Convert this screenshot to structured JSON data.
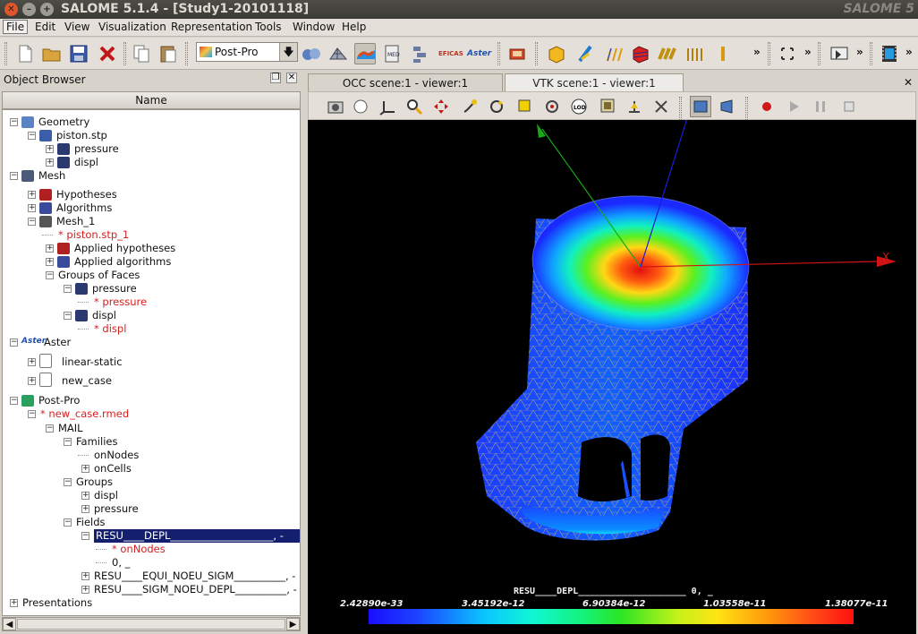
{
  "window": {
    "title": "SALOME 5.1.4 - [Study1-20101118]",
    "logo": "SALOME 5"
  },
  "menu": [
    "File",
    "Edit",
    "View",
    "Visualization",
    "Representation",
    "Tools",
    "Window",
    "Help"
  ],
  "toolbar": {
    "module_combo": "Post-Pro",
    "more": "»",
    "icons": [
      "new-document-icon",
      "open-folder-icon",
      "save-icon",
      "close-study-icon",
      "copy-icon",
      "paste-icon",
      "geometry-module-icon",
      "mesh-module-icon",
      "postpro-module-icon",
      "med-module-icon",
      "yacs-module-icon",
      "eficas-module-icon",
      "aster-module-icon",
      "import-med-icon",
      "create-scalar-map-icon",
      "create-deformed-shape-icon",
      "create-vectors-icon",
      "create-iso-surfaces-icon",
      "create-cut-planes-icon",
      "create-cut-lines-icon",
      "create-plot3d-icon",
      "select-icon",
      "dump-view-icon",
      "animation-icon"
    ],
    "eficas_label": "EFICAS",
    "aster_label": "Aster"
  },
  "object_browser": {
    "title": "Object Browser",
    "column_header": "Name",
    "tree": [
      {
        "label": "Geometry",
        "level": 0,
        "expander": "−",
        "red": false,
        "icon": "geometry-icon"
      },
      {
        "label": "piston.stp",
        "level": 1,
        "expander": "−",
        "red": false,
        "icon": "solid-icon"
      },
      {
        "label": "pressure",
        "level": 2,
        "expander": "+",
        "red": false,
        "icon": "face-group-icon"
      },
      {
        "label": "displ",
        "level": 2,
        "expander": "+",
        "red": false,
        "icon": "face-group-icon"
      },
      {
        "label": "Mesh",
        "level": 0,
        "expander": "−",
        "red": false,
        "icon": "mesh-icon"
      },
      {
        "label": "Hypotheses",
        "level": 1,
        "expander": "+",
        "red": false,
        "icon": "hypothesis-icon"
      },
      {
        "label": "Algorithms",
        "level": 1,
        "expander": "+",
        "red": false,
        "icon": "algorithm-icon"
      },
      {
        "label": "Mesh_1",
        "level": 1,
        "expander": "−",
        "red": false,
        "icon": "mesh-object-icon"
      },
      {
        "label": "* piston.stp_1",
        "level": 2,
        "expander": "",
        "red": true,
        "icon": ""
      },
      {
        "label": "Applied hypotheses",
        "level": 2,
        "expander": "+",
        "red": false,
        "icon": "hypothesis-icon"
      },
      {
        "label": "Applied algorithms",
        "level": 2,
        "expander": "+",
        "red": false,
        "icon": "algorithm-icon"
      },
      {
        "label": "Groups of Faces",
        "level": 2,
        "expander": "−",
        "red": false,
        "icon": ""
      },
      {
        "label": "pressure",
        "level": 3,
        "expander": "−",
        "red": false,
        "icon": "group-icon"
      },
      {
        "label": "* pressure",
        "level": 4,
        "expander": "",
        "red": true,
        "icon": ""
      },
      {
        "label": "displ",
        "level": 3,
        "expander": "−",
        "red": false,
        "icon": "group-icon"
      },
      {
        "label": "* displ",
        "level": 4,
        "expander": "",
        "red": true,
        "icon": ""
      },
      {
        "label": "Aster",
        "level": 0,
        "expander": "−",
        "red": false,
        "icon": "aster-icon"
      },
      {
        "label": "linear-static",
        "level": 1,
        "expander": "+",
        "red": false,
        "icon": "study-case-icon"
      },
      {
        "label": "new_case",
        "level": 1,
        "expander": "+",
        "red": false,
        "icon": "study-case-ok-icon"
      },
      {
        "label": "Post-Pro",
        "level": 0,
        "expander": "−",
        "red": false,
        "icon": "postpro-icon"
      },
      {
        "label": "* new_case.rmed",
        "level": 1,
        "expander": "−",
        "red": true,
        "icon": ""
      },
      {
        "label": "MAIL",
        "level": 2,
        "expander": "−",
        "red": false,
        "icon": ""
      },
      {
        "label": "Families",
        "level": 3,
        "expander": "−",
        "red": false,
        "icon": ""
      },
      {
        "label": "onNodes",
        "level": 4,
        "expander": "",
        "red": false,
        "icon": ""
      },
      {
        "label": "onCells",
        "level": 4,
        "expander": "+",
        "red": false,
        "icon": ""
      },
      {
        "label": "Groups",
        "level": 3,
        "expander": "−",
        "red": false,
        "icon": ""
      },
      {
        "label": "displ",
        "level": 4,
        "expander": "+",
        "red": false,
        "icon": ""
      },
      {
        "label": "pressure",
        "level": 4,
        "expander": "+",
        "red": false,
        "icon": ""
      },
      {
        "label": "Fields",
        "level": 3,
        "expander": "−",
        "red": false,
        "icon": ""
      },
      {
        "label": "RESU____DEPL____________________, -",
        "level": 4,
        "expander": "−",
        "red": false,
        "icon": "",
        "selected": true
      },
      {
        "label": "* onNodes",
        "level": 5,
        "expander": "",
        "red": true,
        "icon": ""
      },
      {
        "label": "0, _",
        "level": 5,
        "expander": "",
        "red": false,
        "icon": ""
      },
      {
        "label": "RESU____EQUI_NOEU_SIGM__________, -",
        "level": 4,
        "expander": "+",
        "red": false,
        "icon": ""
      },
      {
        "label": "RESU____SIGM_NOEU_DEPL__________, -",
        "level": 4,
        "expander": "+",
        "red": false,
        "icon": ""
      },
      {
        "label": "Presentations",
        "level": 0,
        "expander": "+",
        "red": false,
        "icon": ""
      }
    ]
  },
  "viewer": {
    "tabs": [
      "OCC scene:1 - viewer:1",
      "VTK scene:1 - viewer:1"
    ],
    "active_tab": 1,
    "close": "✕",
    "axis_x_label": "X",
    "field_title": "RESU____DEPL____________________ 0, _",
    "colorbar_ticks": [
      "2.42890e-33",
      "3.45192e-12",
      "6.90384e-12",
      "1.03558e-11",
      "1.38077e-11"
    ],
    "colors": {
      "x_axis": "#d21414",
      "y_axis": "#18a818",
      "z_axis": "#1a1ad8"
    }
  }
}
